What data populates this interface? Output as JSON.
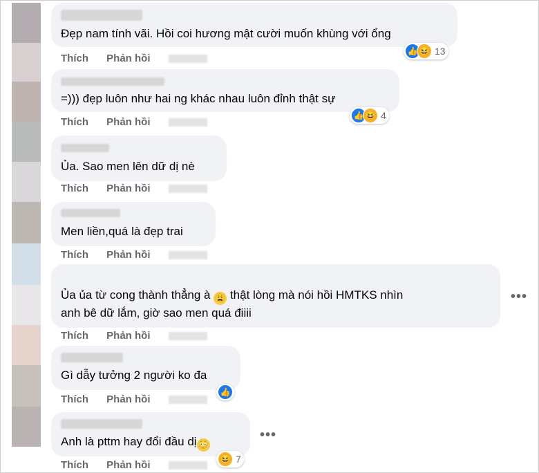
{
  "actions": {
    "like": "Thích",
    "reply": "Phản hồi"
  },
  "avatar_colors": [
    "#b3acb0",
    "#d8cfd0",
    "#bfb4b0",
    "#b9bbba",
    "#d9d7d9",
    "#bcb7b1",
    "#d2dfe8",
    "#e8e6e8",
    "#e6d3cc",
    "#c7c1bc",
    "#b9b4b3"
  ],
  "comments": [
    {
      "text": "Đẹp nam tính vãi. Hồi coi hương mật cười muốn khùng với ổng",
      "reaction_count": "13"
    },
    {
      "text": "=))) đẹp luôn như hai ng khác nhau luôn đỉnh thật sự",
      "reaction_count": "4"
    },
    {
      "text": "Ủa. Sao men lên dữ dị nè"
    },
    {
      "text": "Men liền,quá là đẹp trai"
    },
    {
      "text_line1a": "Ủa ủa từ cong thành thẳng à",
      "emoji": "😩",
      "text_line1b": "thật lòng mà nói hồi HMTKS nhìn",
      "text_line2": "anh bê dữ lắm, giờ sao men quá điiii",
      "more": "•••"
    },
    {
      "text": "Gì dẫy tưởng 2 người ko đa"
    },
    {
      "text": "Anh là pttm hay đổi đầu dị",
      "emoji": "😳",
      "reaction_count": "7",
      "more": "•••"
    }
  ],
  "icons": {
    "like": "like-icon",
    "haha": "haha-icon"
  }
}
